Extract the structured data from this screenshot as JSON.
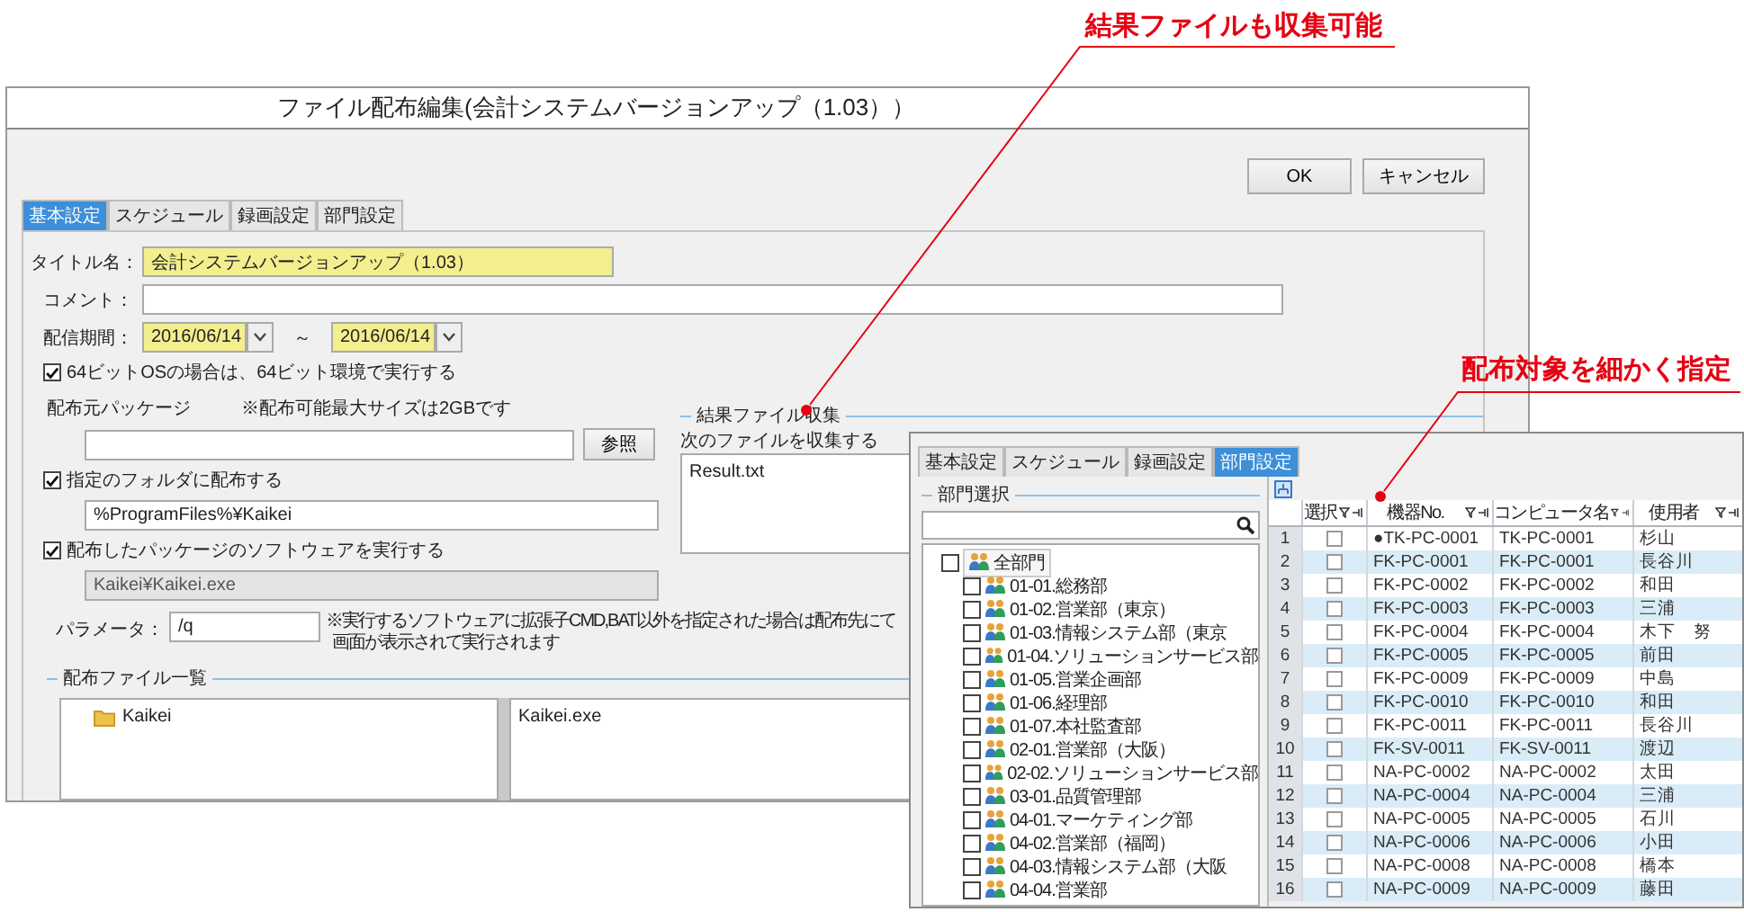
{
  "callouts": [
    {
      "text": "結果ファイルも収集可能"
    },
    {
      "text": "配布対象を細かく指定"
    }
  ],
  "dialog": {
    "title": "ファイル配布編集(会計システムバージョンアップ（1.03））",
    "buttons": [
      "OK",
      "キャンセル"
    ],
    "tabs": [
      {
        "label": "基本設定",
        "selected": true
      },
      {
        "label": "スケジュール",
        "selected": false
      },
      {
        "label": "録画設定",
        "selected": false
      },
      {
        "label": "部門設定",
        "selected": false
      }
    ],
    "form": {
      "title": {
        "label": "タイトル名：",
        "value": "会計システムバージョンアップ（1.03）"
      },
      "comment": {
        "label": "コメント："
      },
      "period": {
        "label": "配信期間：",
        "start": "2016/06/14",
        "separator": "～",
        "end": "2016/06/14"
      },
      "run_64bit": {
        "label": "64ビットOSの場合は、64ビット環境で実行する",
        "checked": true
      },
      "package": {
        "label": "配布元パッケージ",
        "note": "※配布可能最大サイズは2GBです",
        "browse_button": "参照"
      },
      "target_folder": {
        "label": "指定のフォルダに配布する",
        "checked": true,
        "value": "%ProgramFiles%¥Kaikei"
      },
      "run_software": {
        "label": "配布したパッケージのソフトウェアを実行する",
        "checked": true,
        "value": "Kaikei¥Kaikei.exe",
        "disabled": true
      },
      "parameter": {
        "label": "パラメータ：",
        "value": "/q",
        "note_lines": [
          "※実行するソフトウェアに拡張子CMD,BAT以外を指定された場合は配布先にて",
          "画面が表示されて実行されます"
        ]
      },
      "result_files": {
        "title": "結果ファイル収集",
        "label": "次のファイルを収集する",
        "files": [
          "Result.txt"
        ]
      },
      "file_list": {
        "title": "配布ファイル一覧",
        "folders": [
          "Kaikei"
        ],
        "files": [
          "Kaikei.exe"
        ]
      }
    }
  },
  "dept_window": {
    "tabs": [
      {
        "label": "基本設定",
        "selected": false
      },
      {
        "label": "スケジュール",
        "selected": false
      },
      {
        "label": "録画設定",
        "selected": false
      },
      {
        "label": "部門設定",
        "selected": true
      }
    ],
    "group_title": "部門選択",
    "tree": {
      "label": "全部門",
      "checked": false,
      "children": [
        {
          "label": "01-01.総務部",
          "checked": false
        },
        {
          "label": "01-02.営業部（東京）",
          "checked": false
        },
        {
          "label": "01-03.情報システム部（東京",
          "checked": false
        },
        {
          "label": "01-04.ソリューションサービス部",
          "checked": false
        },
        {
          "label": "01-05.営業企画部",
          "checked": false
        },
        {
          "label": "01-06.経理部",
          "checked": false
        },
        {
          "label": "01-07.本社監査部",
          "checked": false
        },
        {
          "label": "02-01.営業部（大阪）",
          "checked": false
        },
        {
          "label": "02-02.ソリューションサービス部",
          "checked": false
        },
        {
          "label": "03-01.品質管理部",
          "checked": false
        },
        {
          "label": "04-01.マーケティング部",
          "checked": false
        },
        {
          "label": "04-02.営業部（福岡）",
          "checked": false
        },
        {
          "label": "04-03.情報システム部（大阪",
          "checked": false
        },
        {
          "label": "04-04.営業部",
          "checked": false
        }
      ]
    },
    "grid": {
      "columns": [
        "選択",
        "機器No.",
        "コンピュータ名",
        "使用者"
      ],
      "rows": [
        {
          "no": "1",
          "checked": false,
          "machine": "●TK-PC-0001",
          "computer": "TK-PC-0001",
          "user": "杉山"
        },
        {
          "no": "2",
          "checked": false,
          "machine": "FK-PC-0001",
          "computer": "FK-PC-0001",
          "user": "長谷川"
        },
        {
          "no": "3",
          "checked": false,
          "machine": "FK-PC-0002",
          "computer": "FK-PC-0002",
          "user": "和田"
        },
        {
          "no": "4",
          "checked": false,
          "machine": "FK-PC-0003",
          "computer": "FK-PC-0003",
          "user": "三浦"
        },
        {
          "no": "5",
          "checked": false,
          "machine": "FK-PC-0004",
          "computer": "FK-PC-0004",
          "user": "木下　努"
        },
        {
          "no": "6",
          "checked": false,
          "machine": "FK-PC-0005",
          "computer": "FK-PC-0005",
          "user": "前田"
        },
        {
          "no": "7",
          "checked": false,
          "machine": "FK-PC-0009",
          "computer": "FK-PC-0009",
          "user": "中島"
        },
        {
          "no": "8",
          "checked": false,
          "machine": "FK-PC-0010",
          "computer": "FK-PC-0010",
          "user": "和田"
        },
        {
          "no": "9",
          "checked": false,
          "machine": "FK-PC-0011",
          "computer": "FK-PC-0011",
          "user": "長谷川"
        },
        {
          "no": "10",
          "checked": false,
          "machine": "FK-SV-0011",
          "computer": "FK-SV-0011",
          "user": "渡辺"
        },
        {
          "no": "11",
          "checked": false,
          "machine": "NA-PC-0002",
          "computer": "NA-PC-0002",
          "user": "太田"
        },
        {
          "no": "12",
          "checked": false,
          "machine": "NA-PC-0004",
          "computer": "NA-PC-0004",
          "user": "三浦"
        },
        {
          "no": "13",
          "checked": false,
          "machine": "NA-PC-0005",
          "computer": "NA-PC-0005",
          "user": "石川"
        },
        {
          "no": "14",
          "checked": false,
          "machine": "NA-PC-0006",
          "computer": "NA-PC-0006",
          "user": "小田"
        },
        {
          "no": "15",
          "checked": false,
          "machine": "NA-PC-0008",
          "computer": "NA-PC-0008",
          "user": "橋本"
        },
        {
          "no": "16",
          "checked": false,
          "machine": "NA-PC-0009",
          "computer": "NA-PC-0009",
          "user": "藤田"
        }
      ]
    }
  }
}
